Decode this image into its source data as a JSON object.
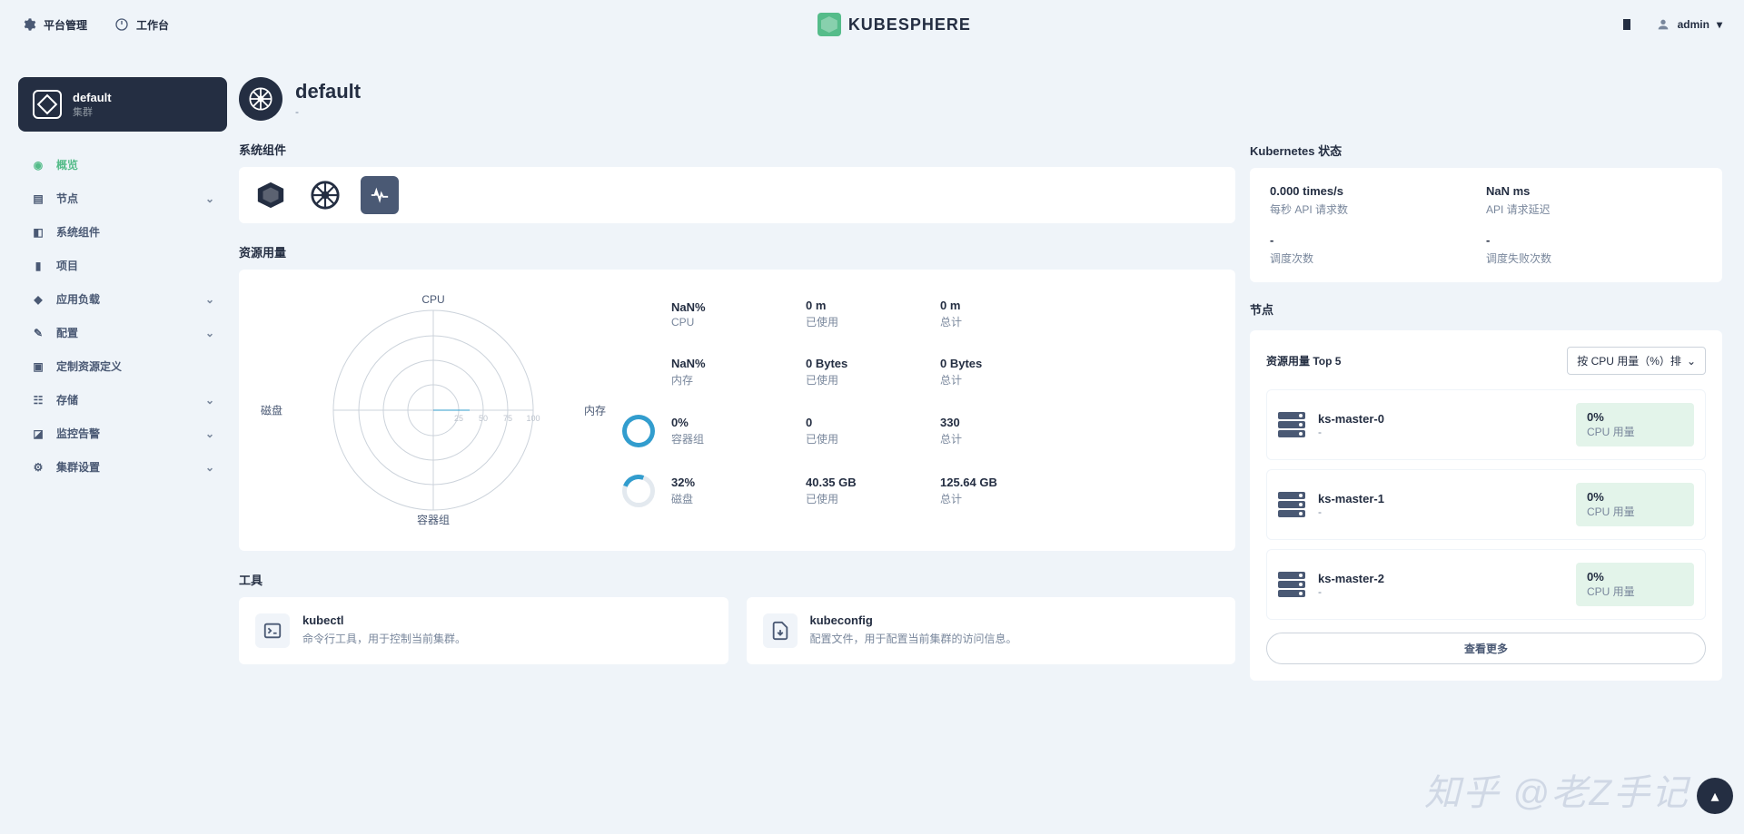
{
  "topbar": {
    "platform": "平台管理",
    "workbench": "工作台",
    "brand": "KUBESPHERE",
    "user": "admin"
  },
  "cluster": {
    "name": "default",
    "sub": "集群"
  },
  "nav": [
    {
      "label": "概览",
      "active": true,
      "expandable": false
    },
    {
      "label": "节点",
      "active": false,
      "expandable": true
    },
    {
      "label": "系统组件",
      "active": false,
      "expandable": false
    },
    {
      "label": "项目",
      "active": false,
      "expandable": false
    },
    {
      "label": "应用负载",
      "active": false,
      "expandable": true
    },
    {
      "label": "配置",
      "active": false,
      "expandable": true
    },
    {
      "label": "定制资源定义",
      "active": false,
      "expandable": false
    },
    {
      "label": "存储",
      "active": false,
      "expandable": true
    },
    {
      "label": "监控告警",
      "active": false,
      "expandable": true
    },
    {
      "label": "集群设置",
      "active": false,
      "expandable": true
    }
  ],
  "page": {
    "title": "default",
    "sub": "-"
  },
  "sections": {
    "components": "系统组件",
    "resource": "资源用量",
    "tools": "工具",
    "k8s": "Kubernetes 状态",
    "nodes": "节点"
  },
  "radar": {
    "top": "CPU",
    "right": "内存",
    "bottom": "容器组",
    "left": "磁盘"
  },
  "resource_rows": [
    {
      "pct": "NaN%",
      "name": "CPU",
      "used": "0 m",
      "usedLabel": "已使用",
      "total": "0 m",
      "totalLabel": "总计",
      "ring": "blank"
    },
    {
      "pct": "NaN%",
      "name": "内存",
      "used": "0 Bytes",
      "usedLabel": "已使用",
      "total": "0 Bytes",
      "totalLabel": "总计",
      "ring": "blank"
    },
    {
      "pct": "0%",
      "name": "容器组",
      "used": "0",
      "usedLabel": "已使用",
      "total": "330",
      "totalLabel": "总计",
      "ring": "full"
    },
    {
      "pct": "32%",
      "name": "磁盘",
      "used": "40.35 GB",
      "usedLabel": "已使用",
      "total": "125.64 GB",
      "totalLabel": "总计",
      "ring": "d32"
    }
  ],
  "tools": [
    {
      "title": "kubectl",
      "desc": "命令行工具，用于控制当前集群。"
    },
    {
      "title": "kubeconfig",
      "desc": "配置文件，用于配置当前集群的访问信息。"
    }
  ],
  "k8s_status": [
    {
      "val": "0.000 times/s",
      "lbl": "每秒 API 请求数"
    },
    {
      "val": "NaN ms",
      "lbl": "API 请求延迟"
    },
    {
      "val": "-",
      "lbl": "调度次数"
    },
    {
      "val": "-",
      "lbl": "调度失败次数"
    }
  ],
  "top5": {
    "title": "资源用量 Top 5",
    "sort": "按 CPU 用量（%）排",
    "nodes": [
      {
        "name": "ks-master-0",
        "sub": "-",
        "pct": "0%",
        "metric": "CPU 用量"
      },
      {
        "name": "ks-master-1",
        "sub": "-",
        "pct": "0%",
        "metric": "CPU 用量"
      },
      {
        "name": "ks-master-2",
        "sub": "-",
        "pct": "0%",
        "metric": "CPU 用量"
      }
    ],
    "view_more": "查看更多"
  },
  "watermark": "知乎 @老Z手记"
}
